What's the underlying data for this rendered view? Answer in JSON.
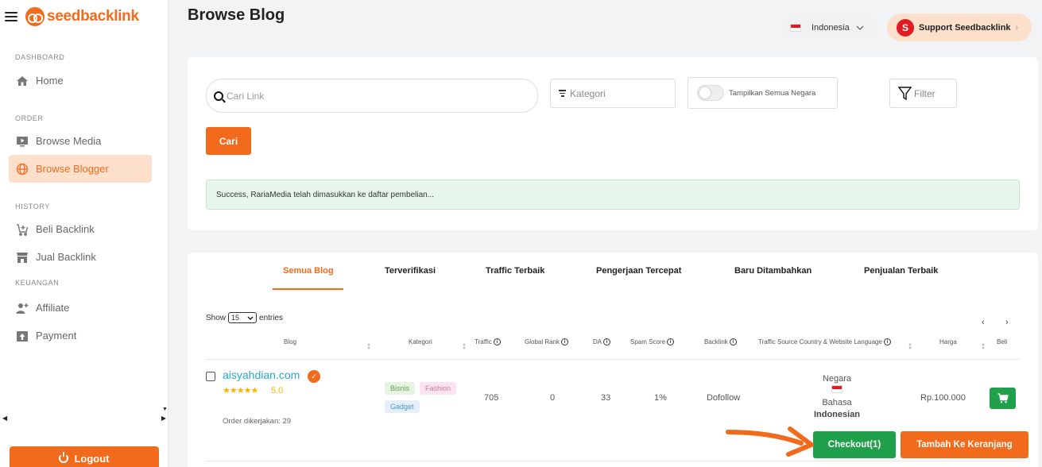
{
  "brand": {
    "name": "seedbacklink"
  },
  "sidebar": {
    "sections": [
      {
        "label": "DASHBOARD",
        "items": [
          {
            "label": "Home",
            "icon": "home-icon"
          }
        ]
      },
      {
        "label": "ORDER",
        "items": [
          {
            "label": "Browse Media",
            "icon": "monitor-play-icon"
          },
          {
            "label": "Browse Blogger",
            "icon": "globe-icon",
            "active": true
          }
        ]
      },
      {
        "label": "HISTORY",
        "items": [
          {
            "label": "Beli Backlink",
            "icon": "cart-plus-icon"
          },
          {
            "label": "Jual Backlink",
            "icon": "store-icon"
          }
        ]
      },
      {
        "label": "KEUANGAN",
        "items": [
          {
            "label": "Affiliate",
            "icon": "user-plus-icon"
          },
          {
            "label": "Payment",
            "icon": "upload-icon"
          }
        ]
      }
    ],
    "logout": "Logout"
  },
  "header": {
    "title": "Browse Blog",
    "country": "Indonesia",
    "support": "Support Seedbacklink",
    "support_initial": "S"
  },
  "search": {
    "placeholder": "Cari Link",
    "kategori": "Kategori",
    "toggle_label": "Tampilkan Semua Negara",
    "filter": "Filter",
    "cari": "Cari"
  },
  "alert": "Success, RariaMedia telah dimasukkan ke daftar pembelian...",
  "tabs": [
    "Semua Blog",
    "Terverifikasi",
    "Traffic Terbaik",
    "Pengerjaan Tercepat",
    "Baru Ditambahkan",
    "Penjualan Terbaik"
  ],
  "table": {
    "show_label": "Show",
    "show_value": "15",
    "entries_label": "entries",
    "pager_prev": "‹",
    "pager_next": "›",
    "columns": [
      "Blog",
      "Kategori",
      "Traffic",
      "Global Rank",
      "DA",
      "Spam Score",
      "Backlink",
      "Traffic Source Country & Website Language",
      "Harga",
      "Beli"
    ],
    "rows": [
      {
        "blog": "aisyahdian.com",
        "stars": "★★★★★",
        "rating": "5.0",
        "order_done": "Order dikerjakan: 29",
        "categories": [
          "Bisnis",
          "Fashion",
          "Gadget"
        ],
        "traffic": "705",
        "global_rank": "0",
        "da": "33",
        "spam_score": "1%",
        "backlink": "Dofollow",
        "negara_label": "Negara",
        "bahasa_label": "Bahasa",
        "language": "Indonesian",
        "harga": "Rp.100.000"
      }
    ]
  },
  "actions": {
    "checkout": "Checkout(1)",
    "add_cart": "Tambah Ke Keranjang"
  },
  "colors": {
    "accent": "#f26b1d",
    "success": "#21a04b",
    "link": "#2aa9c7"
  }
}
